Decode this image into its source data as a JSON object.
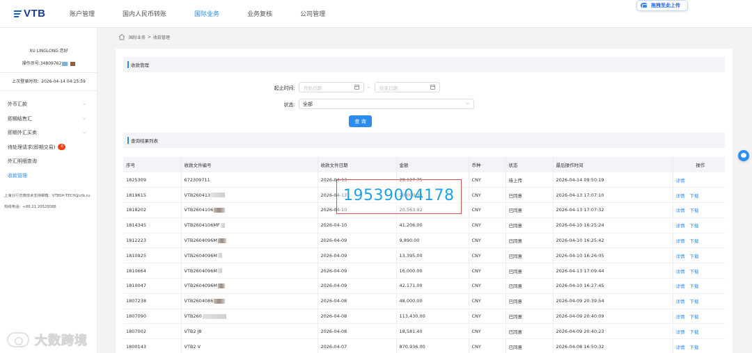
{
  "header": {
    "logo_text": "VTB",
    "nav": [
      "账户管理",
      "国内人民币转账",
      "国际业务",
      "业务复核",
      "公司管理"
    ],
    "active_nav_index": 2,
    "upload_button": "拖拽至此上传"
  },
  "sidebar": {
    "user_name": "XU LINGLONG 您好",
    "operator_id": "操作员号:34809762",
    "last_login": "上次登录时间：2026-04-14 04:25:59",
    "menu": [
      {
        "label": "外币汇款",
        "has_chevron": true
      },
      {
        "label": "即期结售汇",
        "has_chevron": true
      },
      {
        "label": "即期外汇买卖",
        "has_chevron": true
      },
      {
        "label": "待处理请求(即期交易)",
        "badge": "0"
      },
      {
        "label": "外汇明细查询"
      },
      {
        "label": "收款管理",
        "active": true
      }
    ],
    "support_note": "上海分行仿真技术支持邮箱：VTBSH-TECH@vtb.ru",
    "support_phone": "热线电话：+86 21 20528088"
  },
  "breadcrumb": {
    "parent": "国际业务",
    "separator": ">",
    "current": "收款管理"
  },
  "search": {
    "section_title": "收款管理",
    "date_label": "起止时间:",
    "start_placeholder": "开始日期",
    "end_placeholder": "结束日期",
    "range_dash": "-",
    "status_label": "状态:",
    "status_value": "全部",
    "query_button": "查 询"
  },
  "results": {
    "section_title": "查询结果列表",
    "columns": [
      "序号",
      "收款文件编号",
      "收款文件日期",
      "金额",
      "币种",
      "状态",
      "最后操作时间",
      "操作"
    ],
    "rows": [
      {
        "id": "1825309",
        "file_no": "672309711",
        "date": "2026-04-13",
        "amount": "29,127.75",
        "currency": "CNY",
        "status": "待上传",
        "last_op": "2026-04-14 09:50:19",
        "actions": [
          "详情"
        ]
      },
      {
        "id": "1819615",
        "file_no": "VTB260413",
        "date": "2026-04-13",
        "amount": "20,000.00",
        "currency": "CNY",
        "status": "已同意",
        "last_op": "2026-04-13 17:07:10",
        "actions": [
          "详情",
          "下载"
        ]
      },
      {
        "id": "1818202",
        "file_no": "VTB2604106",
        "date": "2026-04-10",
        "amount": "20,563.92",
        "currency": "CNY",
        "status": "已同意",
        "last_op": "2026-04-13 17:07:32",
        "actions": [
          "详情",
          "下载"
        ]
      },
      {
        "id": "1814345",
        "file_no": "VTB2604106MF",
        "date": "2026-04-10",
        "amount": "41,206.00",
        "currency": "CNY",
        "status": "已同意",
        "last_op": "2026-04-10 16:25:24",
        "actions": [
          "详情",
          "下载"
        ]
      },
      {
        "id": "1812223",
        "file_no": "VTB2604096M",
        "date": "2026-04-09",
        "amount": "9,890.00",
        "currency": "CNY",
        "status": "已同意",
        "last_op": "2026-04-10 16:25:42",
        "actions": [
          "详情",
          "下载"
        ]
      },
      {
        "id": "1810925",
        "file_no": "VTB2604096M",
        "date": "2026-04-09",
        "amount": "13,395.00",
        "currency": "CNY",
        "status": "已同意",
        "last_op": "2026-04-10 16:26:05",
        "actions": [
          "详情",
          "下载"
        ]
      },
      {
        "id": "1810664",
        "file_no": "VTB2604096M",
        "date": "2026-04-09",
        "amount": "16,000.00",
        "currency": "CNY",
        "status": "已同意",
        "last_op": "2026-04-13 17:09:44",
        "actions": [
          "详情",
          "下载"
        ]
      },
      {
        "id": "1810047",
        "file_no": "VTB2604096M",
        "date": "2026-04-09",
        "amount": "42,171.00",
        "currency": "CNY",
        "status": "已同意",
        "last_op": "2026-04-10 16:27:45",
        "actions": [
          "详情",
          "下载"
        ]
      },
      {
        "id": "1807238",
        "file_no": "VTB2604086",
        "date": "2026-04-08",
        "amount": "48,000.00",
        "currency": "CNY",
        "status": "已同意",
        "last_op": "2026-04-09 20:39:54",
        "actions": [
          "详情",
          "下载"
        ]
      },
      {
        "id": "1807090",
        "file_no": "VTB260",
        "date": "2026-04-08",
        "amount": "113,430.00",
        "currency": "CNY",
        "status": "已同意",
        "last_op": "2026-04-09 20:40:09",
        "actions": [
          "详情",
          "下载"
        ]
      },
      {
        "id": "1807002",
        "file_no": "VTB2 J8",
        "date": "2026-04-08",
        "amount": "18,581.40",
        "currency": "CNY",
        "status": "已同意",
        "last_op": "2026-04-09 20:40:23",
        "actions": [
          "详情",
          "下载"
        ]
      },
      {
        "id": "1800143",
        "file_no": "VTB2 V",
        "date": "2026-04-07",
        "amount": "870,936.00",
        "currency": "CNY",
        "status": "已同意",
        "last_op": "2026-04-08 16:50:32",
        "actions": [
          "详情",
          "下载"
        ]
      }
    ]
  },
  "overlay": {
    "phone_number": "19539004178"
  },
  "watermark": {
    "text": "大数跨境"
  },
  "colors": {
    "accent": "#2d8cf0",
    "brand": "#1a3c8f",
    "badge": "#ed4014",
    "overlay_text": "#1ea2e6",
    "overlay_border": "#d9534f"
  }
}
